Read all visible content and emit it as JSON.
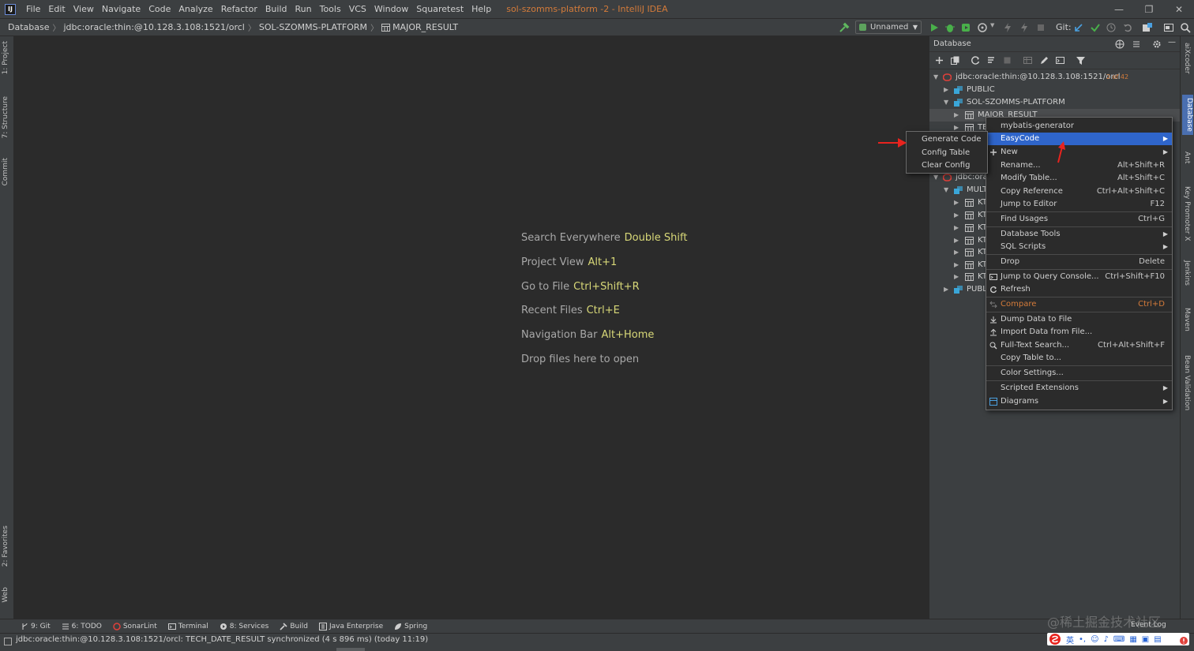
{
  "title_bar": {
    "menu": [
      "File",
      "Edit",
      "View",
      "Navigate",
      "Code",
      "Analyze",
      "Refactor",
      "Build",
      "Run",
      "Tools",
      "VCS",
      "Window",
      "Squaretest",
      "Help"
    ],
    "window_title": "sol-szomms-platform -2 - IntelliJ IDEA",
    "controls": [
      "—",
      "❐",
      "✕"
    ]
  },
  "navbar": {
    "breadcrumbs": [
      "Database",
      "jdbc:oracle:thin:@10.128.3.108:1521/orcl",
      "SOL-SZOMMS-PLATFORM",
      "MAJOR_RESULT"
    ],
    "run_config": "Unnamed",
    "git_label": "Git:"
  },
  "left_stripe": {
    "tabs": [
      "1: Project",
      "7: Structure",
      "Commit",
      "2: Favorites",
      "Web"
    ]
  },
  "editor_hints": [
    {
      "label": "Search Everywhere",
      "key": "Double Shift"
    },
    {
      "label": "Project View",
      "key": "Alt+1"
    },
    {
      "label": "Go to File",
      "key": "Ctrl+Shift+R"
    },
    {
      "label": "Recent Files",
      "key": "Ctrl+E"
    },
    {
      "label": "Navigation Bar",
      "key": "Alt+Home"
    },
    {
      "label": "Drop files here to open",
      "key": ""
    }
  ],
  "database_panel": {
    "title": "Database",
    "tree": [
      {
        "label": "jdbc:oracle:thin:@10.128.3.108:1521/orcl",
        "extra": "2 of 42"
      },
      {
        "label": "PUBLIC",
        "extra": ""
      },
      {
        "label": "SOL-SZOMMS-PLATFORM",
        "extra": ""
      },
      {
        "label": "MAJOR_RESULT",
        "extra": ""
      },
      {
        "label": "TE",
        "extra": ""
      },
      {
        "label": "jdbc:ora",
        "extra": ""
      },
      {
        "label": "MULT",
        "extra": ""
      },
      {
        "label": "KT",
        "extra": ""
      },
      {
        "label": "KT",
        "extra": ""
      },
      {
        "label": "KT",
        "extra": ""
      },
      {
        "label": "KT",
        "extra": ""
      },
      {
        "label": "KT",
        "extra": ""
      },
      {
        "label": "KT",
        "extra": ""
      },
      {
        "label": "KT",
        "extra": ""
      },
      {
        "label": "PUBL",
        "extra": ""
      }
    ]
  },
  "right_stripe": {
    "tabs": [
      "aiXcoder",
      "Database",
      "Ant",
      "Key Promoter X",
      "Jenkins",
      "Maven",
      "Bean Validation"
    ]
  },
  "context_menu": {
    "items": [
      {
        "label": "mybatis-generator",
        "shortcut": "",
        "submenu": false
      },
      {
        "label": "EasyCode",
        "shortcut": "",
        "submenu": true
      },
      {
        "label": "New",
        "shortcut": "",
        "submenu": true
      },
      {
        "label": "Rename...",
        "shortcut": "Alt+Shift+R",
        "submenu": false
      },
      {
        "label": "Modify Table...",
        "shortcut": "Alt+Shift+C",
        "submenu": false
      },
      {
        "label": "Copy Reference",
        "shortcut": "Ctrl+Alt+Shift+C",
        "submenu": false
      },
      {
        "label": "Jump to Editor",
        "shortcut": "F12",
        "submenu": false
      },
      {
        "label": "Find Usages",
        "shortcut": "Ctrl+G",
        "submenu": false
      },
      {
        "label": "Database Tools",
        "shortcut": "",
        "submenu": true
      },
      {
        "label": "SQL Scripts",
        "shortcut": "",
        "submenu": true
      },
      {
        "label": "Drop",
        "shortcut": "Delete",
        "submenu": false
      },
      {
        "label": "Jump to Query Console...",
        "shortcut": "Ctrl+Shift+F10",
        "submenu": false
      },
      {
        "label": "Refresh",
        "shortcut": "",
        "submenu": false
      },
      {
        "label": "Compare",
        "shortcut": "Ctrl+D",
        "submenu": false
      },
      {
        "label": "Dump Data to File",
        "shortcut": "",
        "submenu": false
      },
      {
        "label": "Import Data from File...",
        "shortcut": "",
        "submenu": false
      },
      {
        "label": "Full-Text Search...",
        "shortcut": "Ctrl+Alt+Shift+F",
        "submenu": false
      },
      {
        "label": "Copy Table to...",
        "shortcut": "",
        "submenu": false
      },
      {
        "label": "Color Settings...",
        "shortcut": "",
        "submenu": false
      },
      {
        "label": "Scripted Extensions",
        "shortcut": "",
        "submenu": true
      },
      {
        "label": "Diagrams",
        "shortcut": "",
        "submenu": true
      }
    ],
    "submenu_arrow": "▶"
  },
  "easycode_submenu": {
    "items": [
      "Generate Code",
      "Config Table",
      "Clear Config"
    ]
  },
  "bottom_tabs": [
    "9: Git",
    "6: TODO",
    "SonarLint",
    "Terminal",
    "8: Services",
    "Build",
    "Java Enterprise",
    "Spring"
  ],
  "status_bar": {
    "text": "jdbc:oracle:thin:@10.128.3.108:1521/orcl: TECH_DATE_RESULT synchronized (4 s 896 ms) (today 11:19)",
    "event_log": "Event Log",
    "watermark": "@稀土掘金技术社区",
    "ime_label": "英"
  },
  "colors": {
    "accent_select": "#2f65ca",
    "orange": "#d47b3a",
    "key_yellow": "#d8d878",
    "arrow_red": "#e8231e"
  }
}
